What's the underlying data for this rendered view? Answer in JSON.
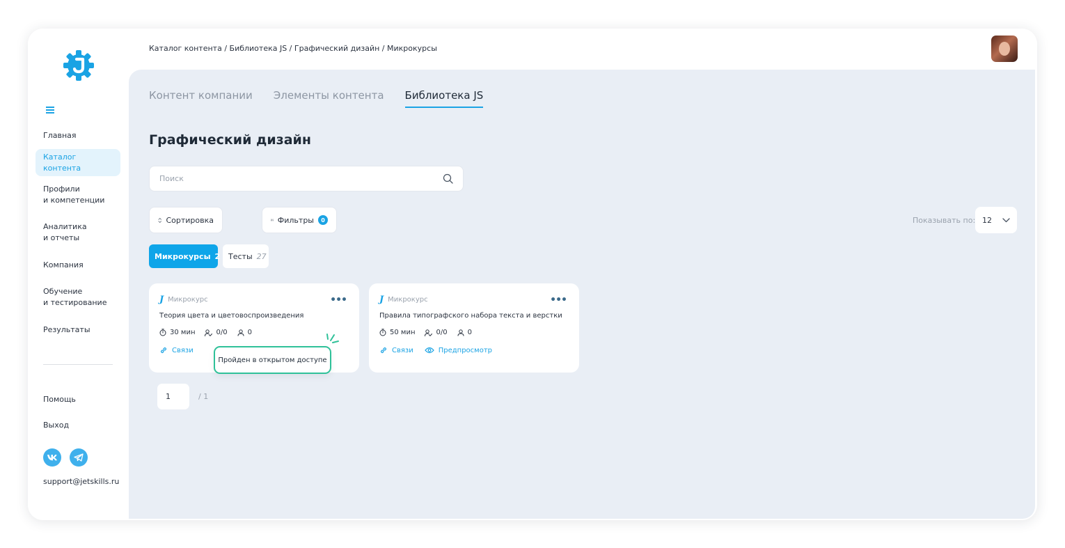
{
  "breadcrumb": "Каталог контента / Библиотека JS / Графический дизайн / Микрокурсы",
  "sidebar": {
    "items": [
      {
        "label": "Главная"
      },
      {
        "label": "Каталог контента"
      },
      {
        "label": "Профили\nи компетенции"
      },
      {
        "label": "Аналитика\nи отчеты"
      },
      {
        "label": "Компания"
      },
      {
        "label": "Обучение\nи тестирование"
      },
      {
        "label": "Результаты"
      },
      {
        "label": "Помощь"
      },
      {
        "label": "Выход"
      }
    ],
    "support_email": "support@jetskills.ru",
    "social": [
      "vk-icon",
      "telegram-icon"
    ]
  },
  "tabs": [
    {
      "label": "Контент компании"
    },
    {
      "label": "Элементы контента"
    },
    {
      "label": "Библиотека JS"
    }
  ],
  "page_title": "Графический дизайн",
  "search": {
    "placeholder": "Поиск"
  },
  "toolbar": {
    "sort_label": "Сортировка",
    "filters_label": "Фильтры",
    "filters_count": "0",
    "perpage_label": "Показывать по:",
    "perpage_value": "12"
  },
  "chips": [
    {
      "label": "Микрокурсы",
      "count": "2"
    },
    {
      "label": "Тесты",
      "count": "27"
    }
  ],
  "cards": [
    {
      "type_label": "Микрокурс",
      "title": "Теория цвета и цветовоспроизведения",
      "duration": "30 мин",
      "progress": "0/0",
      "users": "0",
      "links_label": "Связи",
      "preview_label": ""
    },
    {
      "type_label": "Микрокурс",
      "title": "Правила типографского набора текста и верстки",
      "duration": "50 мин",
      "progress": "0/0",
      "users": "0",
      "links_label": "Связи",
      "preview_label": "Предпросмотр"
    }
  ],
  "tooltip": "Пройден в открытом доступе",
  "pagination": {
    "current": "1",
    "total": "/ 1"
  },
  "colors": {
    "accent": "#1aa3e4",
    "highlight": "#2fc199",
    "background": "#e9eef5"
  }
}
